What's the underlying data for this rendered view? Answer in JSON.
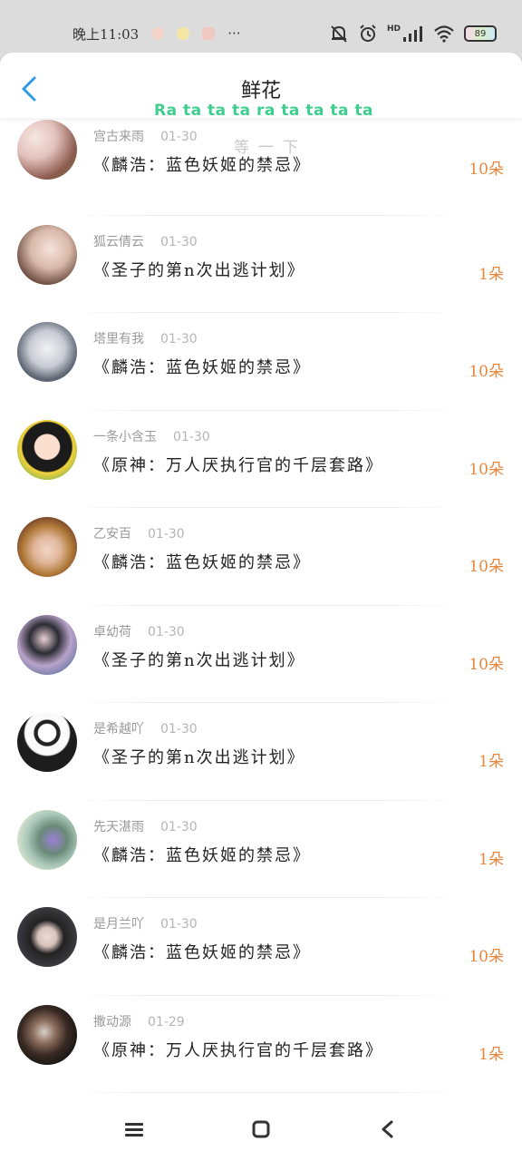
{
  "status": {
    "time": "晚上11:03",
    "more": "···",
    "battery": "89",
    "network": "HD"
  },
  "header": {
    "title": "鲜花",
    "marquee": "Ra ta ta ta ra ta ta ta ta",
    "watermark": "等一下"
  },
  "rows": [
    {
      "name": "宫古来雨",
      "date": "01-30",
      "gift": "《麟浩：蓝色妖姬的禁忌》",
      "count": "10朵"
    },
    {
      "name": "狐云倩云",
      "date": "01-30",
      "gift": "《圣子的第n次出逃计划》",
      "count": "1朵"
    },
    {
      "name": "塔里有我",
      "date": "01-30",
      "gift": "《麟浩：蓝色妖姬的禁忌》",
      "count": "10朵"
    },
    {
      "name": "一条小含玉",
      "date": "01-30",
      "gift": "《原神：万人厌执行官的千层套路》",
      "count": "10朵"
    },
    {
      "name": "乙安百",
      "date": "01-30",
      "gift": "《麟浩：蓝色妖姬的禁忌》",
      "count": "10朵"
    },
    {
      "name": "卓幼荷",
      "date": "01-30",
      "gift": "《圣子的第n次出逃计划》",
      "count": "10朵"
    },
    {
      "name": "是希越吖",
      "date": "01-30",
      "gift": "《圣子的第n次出逃计划》",
      "count": "1朵"
    },
    {
      "name": "先天湛雨",
      "date": "01-30",
      "gift": "《麟浩：蓝色妖姬的禁忌》",
      "count": "1朵"
    },
    {
      "name": "是月兰吖",
      "date": "01-30",
      "gift": "《麟浩：蓝色妖姬的禁忌》",
      "count": "10朵"
    },
    {
      "name": "撒动源",
      "date": "01-29",
      "gift": "《原神：万人厌执行官的千层套路》",
      "count": "1朵"
    }
  ],
  "colors": {
    "accent_blue": "#2f9be8",
    "count_orange": "#e8863c",
    "marquee_green": "#3ecf8e"
  },
  "icons": {
    "back": "chevron-left-icon",
    "nav_menu": "menu-icon",
    "nav_home": "square-home-icon",
    "nav_back": "triangle-back-icon"
  }
}
